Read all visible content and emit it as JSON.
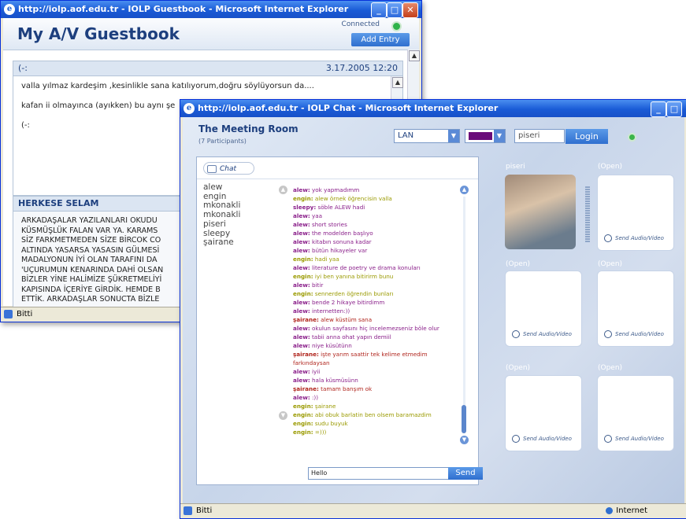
{
  "guestbook_window": {
    "title": "http://iolp.aof.edu.tr - IOLP Guestbook - Microsoft Internet Explorer",
    "heading": "My A/V Guestbook",
    "connection_status": "Connected",
    "add_entry_label": "Add Entry",
    "entries": [
      {
        "subject": "(-:",
        "date": "3.17.2005 12:20",
        "lines": [
          "valla yılmaz kardeşim ,kesinlikle sana katılıyorum,doğru söylüyorsun da....",
          "kafan ii olmayınca (ayıkken) bu aynı şe",
          "(-:"
        ]
      },
      {
        "subject": "HERKESE SELAM",
        "lines": [
          "ARKADAŞALAR YAZILANLARI OKUDU",
          "KÜSMÜŞLÜK FALAN VAR YA.  KARAMS",
          "SİZ FARKMETMEDEN SİZE BİRCOK CO",
          "ALTINDA YASARSA YASASIN GÜLMESİ",
          "MADALYONUN İYİ OLAN TARAFINI DA",
          "'UÇURUMUN KENARINDA DAHİ OLSAN",
          "BİZLER YİNE HALİMİZE ŞÜKRETMELİYİ",
          "KAPISINDA İÇERİYE GİRDİK. HEMDE B",
          "ETTİK. ARKADAŞLAR SONUCTA BİZLE"
        ]
      }
    ],
    "status_text": "Bitti"
  },
  "chat_window": {
    "title": "http://iolp.aof.edu.tr - IOLP Chat - Microsoft Internet Explorer",
    "room_title": "The Meeting Room",
    "participants_text": "(7 Participants)",
    "connection_select": "LAN",
    "username_value": "piseri",
    "login_label": "Login",
    "chat_tab_label": "Chat",
    "users": [
      "alew",
      "engin",
      "mkonakli",
      "mkonakli",
      "piseri",
      "sleepy",
      "şairane"
    ],
    "messages": [
      {
        "name": "alew:",
        "text": " yok yapmadımm",
        "color": "#8a1f8a"
      },
      {
        "name": "engin:",
        "text": " alew örnek öğrencisin valla",
        "color": "#9a9a00"
      },
      {
        "name": "sleepy:",
        "text": " söble ALEW hadi",
        "color": "#8a1f8a"
      },
      {
        "name": "alew:",
        "text": " yaa",
        "color": "#8a1f8a"
      },
      {
        "name": "alew:",
        "text": " short stories",
        "color": "#8a1f8a"
      },
      {
        "name": "alew:",
        "text": " the modelden başlıyo",
        "color": "#8a1f8a"
      },
      {
        "name": "alew:",
        "text": " kitabın sonuna kadar",
        "color": "#8a1f8a"
      },
      {
        "name": "alew:",
        "text": " bütün hikayeler var",
        "color": "#8a1f8a"
      },
      {
        "name": "engin:",
        "text": " hadi yaa",
        "color": "#9a9a00"
      },
      {
        "name": "alew:",
        "text": " literature de poetry ve drama konuları",
        "color": "#8a1f8a"
      },
      {
        "name": "engin:",
        "text": " iyi ben yanına bitirirm bunu",
        "color": "#9a9a00"
      },
      {
        "name": "alew:",
        "text": " bitir",
        "color": "#8a1f8a"
      },
      {
        "name": "engin:",
        "text": " sennerden öğrendin bunları",
        "color": "#9a9a00"
      },
      {
        "name": "alew:",
        "text": " bende 2 hikaye bitirdimm",
        "color": "#8a1f8a"
      },
      {
        "name": "alew:",
        "text": " internetten:))",
        "color": "#8a1f8a"
      },
      {
        "name": "şairane:",
        "text": " alew küstüm sana",
        "color": "#b0241c"
      },
      {
        "name": "alew:",
        "text": " okulun sayfasını hiç incelemezseniz böle olur",
        "color": "#8a1f8a"
      },
      {
        "name": "alew:",
        "text": " tabii anna ohat yapın demiil",
        "color": "#8a1f8a"
      },
      {
        "name": "alew:",
        "text": " niye küsütünn",
        "color": "#8a1f8a"
      },
      {
        "name": "şairane:",
        "text": " işte yarım saattir tek kelime etmedim",
        "color": "#b0241c"
      },
      {
        "name": "",
        "text": "farkındaysan",
        "color": "#b0241c"
      },
      {
        "name": "alew:",
        "text": " iyii",
        "color": "#8a1f8a"
      },
      {
        "name": "alew:",
        "text": " hala küsmüsünn",
        "color": "#8a1f8a"
      },
      {
        "name": "şairane:",
        "text": " tamam banşım ok",
        "color": "#b0241c"
      },
      {
        "name": "alew:",
        "text": " :))",
        "color": "#8a1f8a"
      },
      {
        "name": "engin:",
        "text": " şairane",
        "color": "#9a9a00"
      },
      {
        "name": "engin:",
        "text": " abi obuk barlatin ben olsem baramazdim",
        "color": "#9a9a00"
      },
      {
        "name": "engin:",
        "text": " sudu buyuk",
        "color": "#9a9a00"
      },
      {
        "name": "engin:",
        "text": " =)))",
        "color": "#9a9a00"
      }
    ],
    "message_input_value": "Hello",
    "send_label": "Send",
    "slots": [
      {
        "label": "piseri",
        "send_av": "",
        "has_video": true
      },
      {
        "label": "(Open)",
        "send_av": "Send Audio/Video",
        "has_video": false
      },
      {
        "label": "(Open)",
        "send_av": "Send Audio/Video",
        "has_video": false
      },
      {
        "label": "(Open)",
        "send_av": "Send Audio/Video",
        "has_video": false
      },
      {
        "label": "(Open)",
        "send_av": "Send Audio/Video",
        "has_video": false
      },
      {
        "label": "(Open)",
        "send_av": "Send Audio/Video",
        "has_video": false
      }
    ],
    "status_text": "Bitti",
    "zone_text": "Internet"
  },
  "colors": {
    "accent": "#2f6fcf",
    "title_text": "#1d3f7e",
    "connected_dot": "#2fb34a",
    "selected_color_swatch": "#6a0c7a"
  }
}
